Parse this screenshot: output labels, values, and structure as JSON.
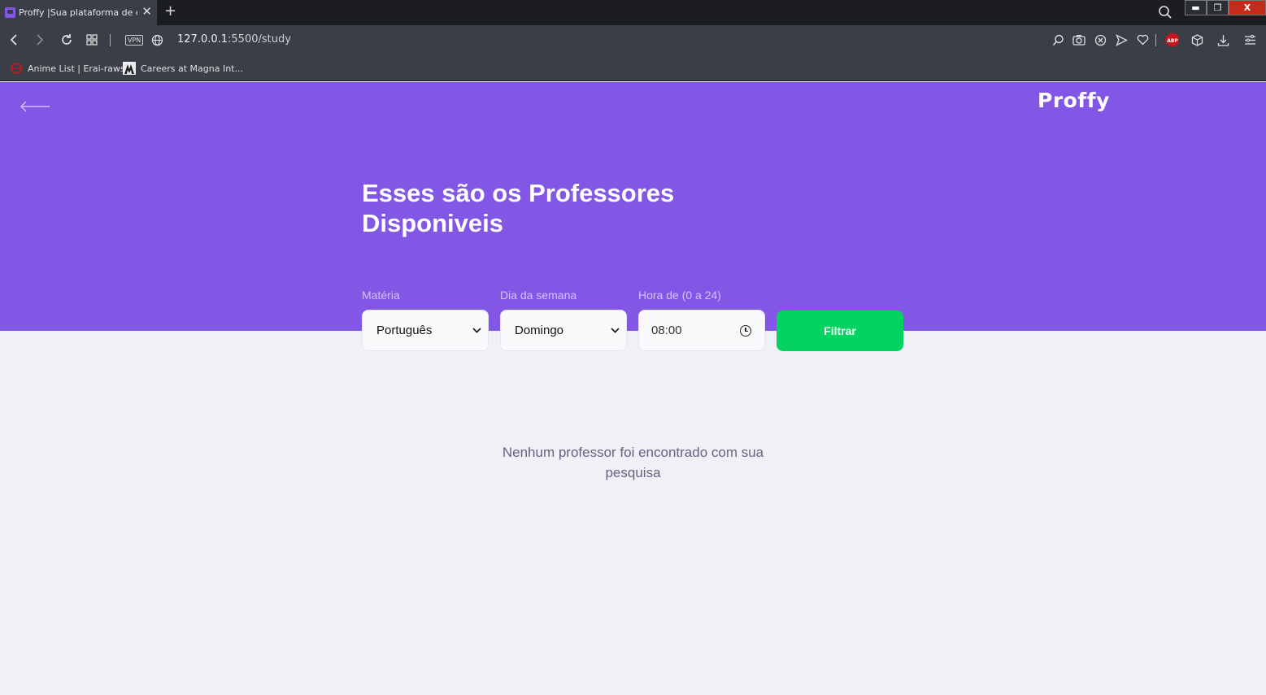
{
  "browser": {
    "tab": {
      "title": "Proffy |Sua plataforma de est",
      "close_glyph": "✕"
    },
    "new_tab_glyph": "+",
    "window": {
      "minimize": "▬",
      "restore": "❐",
      "close": "X"
    },
    "address": {
      "vpn_label": "VPN",
      "url_host": "127.0.0.1",
      "url_rest": ":5500/study"
    },
    "bookmarks": [
      {
        "label": "Anime List | Erai-raws",
        "icon": "erai-raws-icon"
      },
      {
        "label": "Careers at Magna Int...",
        "icon": "magna-icon"
      }
    ],
    "colors": {
      "tabbar": "#1B1D22",
      "chrome": "#3A3F47"
    }
  },
  "page": {
    "logo": "Proffy",
    "title_line1": "Esses são os Professores",
    "title_line2": "Disponiveis",
    "filters": {
      "subject": {
        "label": "Matéria",
        "value": "Português"
      },
      "weekday": {
        "label": "Dia da semana",
        "value": "Domingo"
      },
      "time": {
        "label": "Hora de (0 a 24)",
        "value": "08:00"
      },
      "submit_label": "Filtrar"
    },
    "empty_message": "Nenhum professor foi encontrado com sua pesquisa",
    "colors": {
      "primary": "#8257E5",
      "secondary": "#04D361",
      "background": "#F0F0F7"
    }
  }
}
